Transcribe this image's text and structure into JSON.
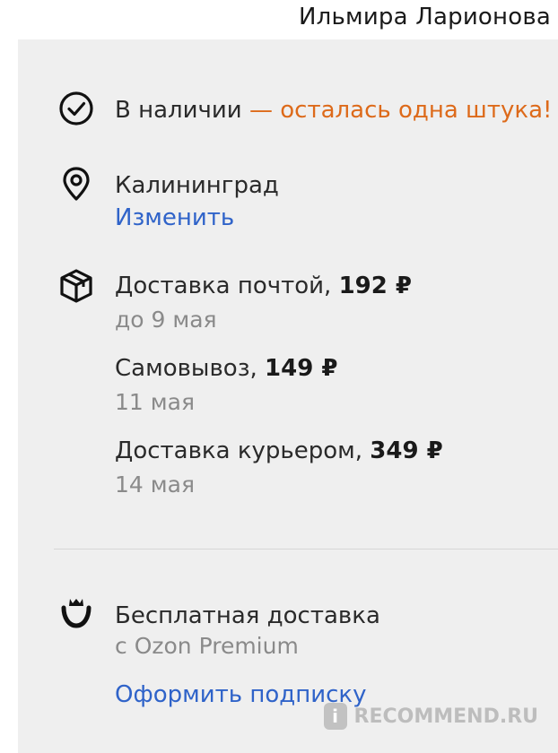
{
  "header": {
    "username": "Ильмира Ларионова"
  },
  "availability": {
    "status": "В наличии",
    "note": "— осталась одна штука!"
  },
  "location": {
    "city": "Калининград",
    "change_link": "Изменить"
  },
  "delivery": [
    {
      "label": "Доставка почтой, ",
      "price": "192 ₽",
      "date": "до 9 мая"
    },
    {
      "label": "Самовывоз, ",
      "price": "149 ₽",
      "date": "11 мая"
    },
    {
      "label": "Доставка курьером, ",
      "price": "349 ₽",
      "date": "14 мая"
    }
  ],
  "premium": {
    "title": "Бесплатная доставка",
    "subtitle": "с Ozon Premium",
    "subscribe_link": "Оформить подписку"
  },
  "watermark": {
    "text": "RECOMMEND.RU",
    "badge": "i"
  },
  "icons": [
    "check-circle-icon",
    "location-pin-icon",
    "box-icon",
    "crown-smile-icon"
  ],
  "colors": {
    "accent_orange": "#dd6a1a",
    "link_blue": "#2f63c9",
    "panel_bg": "#efefef"
  }
}
